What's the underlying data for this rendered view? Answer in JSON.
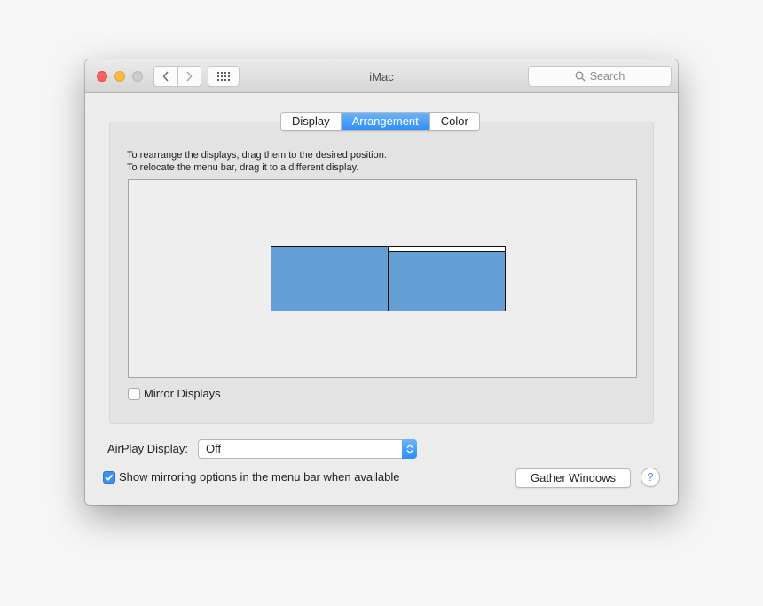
{
  "window": {
    "title": "iMac",
    "search_placeholder": "Search"
  },
  "tabs": [
    {
      "label": "Display",
      "selected": false
    },
    {
      "label": "Arrangement",
      "selected": true
    },
    {
      "label": "Color",
      "selected": false
    }
  ],
  "arrangement": {
    "instruction_line1": "To rearrange the displays, drag them to the desired position.",
    "instruction_line2": "To relocate the menu bar, drag it to a different display.",
    "displays": [
      {
        "id": "display-1",
        "has_menu_bar": false
      },
      {
        "id": "display-2",
        "has_menu_bar": true
      }
    ],
    "mirror_displays_label": "Mirror Displays",
    "mirror_displays_checked": false
  },
  "airplay": {
    "label": "AirPlay Display:",
    "selected_value": "Off"
  },
  "mirroring_option": {
    "label": "Show mirroring options in the menu bar when available",
    "checked": true
  },
  "gather_windows_label": "Gather Windows",
  "help_label": "?",
  "icons": {
    "close": "close-icon",
    "minimize": "minimize-icon",
    "zoom": "zoom-icon",
    "back": "chevron-left-icon",
    "forward": "chevron-right-icon",
    "show_all": "grid-icon",
    "search": "search-icon",
    "popup": "updown-chevron-icon",
    "check": "checkmark-icon"
  },
  "colors": {
    "accent": "#3d8ff0",
    "display_fill": "#659fd6",
    "close": "#fc605c",
    "minimize": "#fdbc40",
    "zoom_disabled": "#cccccc"
  }
}
